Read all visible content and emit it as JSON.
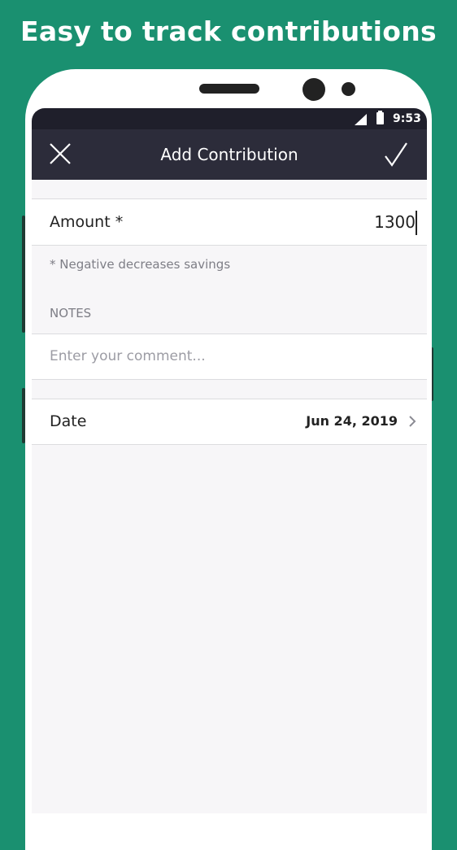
{
  "promo": {
    "headline": "Easy to track contributions"
  },
  "status_bar": {
    "time": "9:53"
  },
  "toolbar": {
    "title": "Add Contribution",
    "close_icon": "close-icon",
    "save_icon": "checkmark-icon"
  },
  "form": {
    "amount_label": "Amount *",
    "amount_value": "1300",
    "amount_hint": "* Negative decreases savings",
    "notes_label": "NOTES",
    "notes_placeholder": "Enter your comment...",
    "notes_value": "",
    "date_label": "Date",
    "date_value": "Jun 24, 2019",
    "date_chevron_icon": "chevron-right-icon"
  },
  "colors": {
    "background": "#1a9070",
    "toolbar": "#2c2c3a",
    "status_bar": "#1f1f2b",
    "screen_background": "#f7f6f8"
  }
}
